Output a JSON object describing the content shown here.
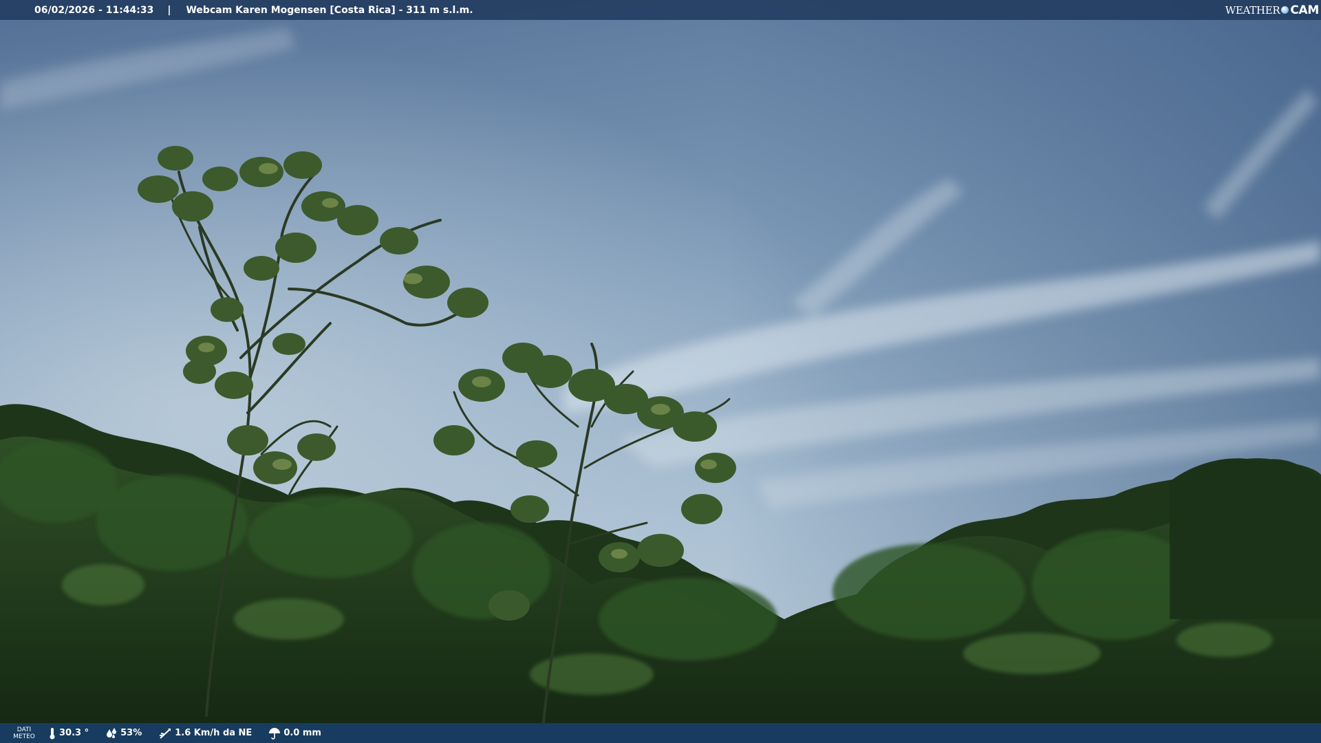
{
  "overlay": {
    "timestamp": "06/02/2026 - 11:44:33",
    "separator": "|",
    "title": "Webcam Karen Mogensen [Costa Rica] - 311 m s.l.m.",
    "logo": {
      "part1": "WEATHER",
      "part2": "CAM"
    }
  },
  "weather": {
    "label_line1": "DATI",
    "label_line2": "METEO",
    "temperature": "30.3 °",
    "humidity": "53%",
    "wind": "1.6 Km/h da NE",
    "rain": "0.0 mm"
  },
  "colors": {
    "top_bar": "#243e62",
    "bottom_bar": "#183e66",
    "sky_top": "#4f6d93",
    "sky_bottom": "#a9c0d4",
    "foliage": "#1f3a1c"
  },
  "icons": {
    "temperature": "thermometer-icon",
    "humidity": "humidity-drops-icon",
    "wind": "wind-vane-icon",
    "rain": "umbrella-icon"
  }
}
